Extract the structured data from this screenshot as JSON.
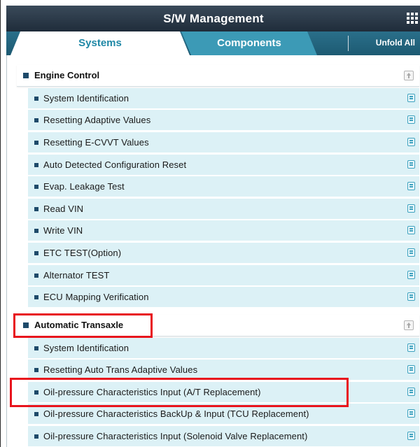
{
  "window": {
    "title": "S/W Management",
    "menu_icon": "grid-menu-icon"
  },
  "tabs": [
    {
      "label": "Systems",
      "active": true
    },
    {
      "label": "Components",
      "active": false
    }
  ],
  "toolbar": {
    "unfold_label": "Unfold All"
  },
  "sections": [
    {
      "title": "Engine Control",
      "items": [
        {
          "label": "System Identification"
        },
        {
          "label": "Resetting Adaptive Values"
        },
        {
          "label": "Resetting E-CVVT Values"
        },
        {
          "label": "Auto Detected Configuration Reset"
        },
        {
          "label": "Evap. Leakage Test"
        },
        {
          "label": "Read VIN"
        },
        {
          "label": "Write VIN"
        },
        {
          "label": "ETC TEST(Option)"
        },
        {
          "label": "Alternator TEST"
        },
        {
          "label": "ECU Mapping Verification"
        }
      ]
    },
    {
      "title": "Automatic Transaxle",
      "items": [
        {
          "label": "System Identification"
        },
        {
          "label": "Resetting Auto Trans Adaptive Values"
        },
        {
          "label": "Oil-pressure Characteristics Input (A/T Replacement)"
        },
        {
          "label": "Oil-pressure Characteristics BackUp & Input (TCU Replacement)"
        },
        {
          "label": "Oil-pressure Characteristics Input (Solenoid Valve Replacement)"
        }
      ]
    }
  ],
  "colors": {
    "header_dark": "#1f2c3a",
    "tab_bar": "#1d5a72",
    "active_tab_text": "#1f88a6",
    "row_background": "#dcf1f6",
    "highlight": "#e8141d"
  }
}
